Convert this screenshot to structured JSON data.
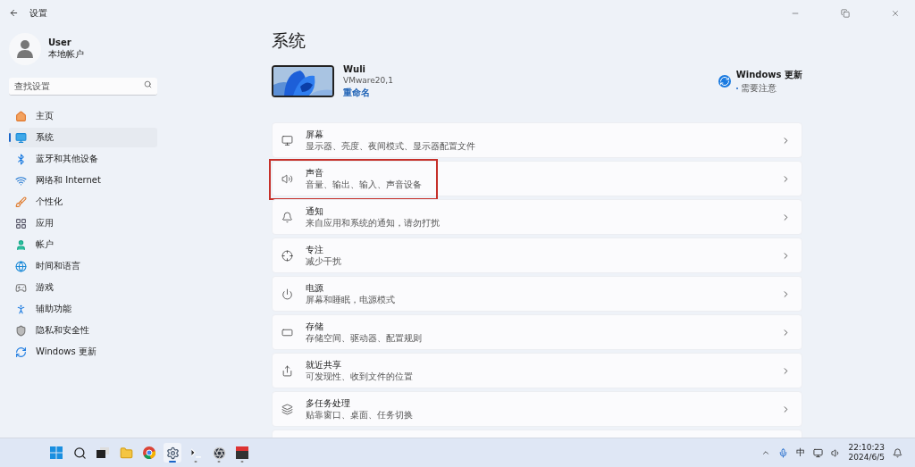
{
  "window": {
    "title": "设置"
  },
  "account": {
    "name": "User",
    "type": "本地帐户"
  },
  "search": {
    "placeholder": "查找设置"
  },
  "nav": [
    {
      "label": "主页",
      "selected": false
    },
    {
      "label": "系统",
      "selected": true
    },
    {
      "label": "蓝牙和其他设备",
      "selected": false
    },
    {
      "label": "网络和 Internet",
      "selected": false
    },
    {
      "label": "个性化",
      "selected": false
    },
    {
      "label": "应用",
      "selected": false
    },
    {
      "label": "帐户",
      "selected": false
    },
    {
      "label": "时间和语言",
      "selected": false
    },
    {
      "label": "游戏",
      "selected": false
    },
    {
      "label": "辅助功能",
      "selected": false
    },
    {
      "label": "隐私和安全性",
      "selected": false
    },
    {
      "label": "Windows 更新",
      "selected": false
    }
  ],
  "page_title": "系统",
  "device": {
    "name": "Wuli",
    "model": "VMware20,1",
    "rename": "重命名"
  },
  "update": {
    "title": "Windows 更新",
    "status": "需要注意"
  },
  "settings": [
    {
      "title": "屏幕",
      "subtitle": "显示器、亮度、夜间模式、显示器配置文件",
      "highlighted": false
    },
    {
      "title": "声音",
      "subtitle": "音量、输出、输入、声音设备",
      "highlighted": true
    },
    {
      "title": "通知",
      "subtitle": "来自应用和系统的通知，请勿打扰",
      "highlighted": false
    },
    {
      "title": "专注",
      "subtitle": "减少干扰",
      "highlighted": false
    },
    {
      "title": "电源",
      "subtitle": "屏幕和睡眠，电源模式",
      "highlighted": false
    },
    {
      "title": "存储",
      "subtitle": "存储空间、驱动器、配置规则",
      "highlighted": false
    },
    {
      "title": "就近共享",
      "subtitle": "可发现性、收到文件的位置",
      "highlighted": false
    },
    {
      "title": "多任务处理",
      "subtitle": "贴靠窗口、桌面、任务切换",
      "highlighted": false
    }
  ],
  "taskbar": {
    "apps": [
      {
        "selected": false
      },
      {
        "selected": false
      },
      {
        "selected": false
      },
      {
        "selected": false
      },
      {
        "selected": false
      },
      {
        "selected": true
      },
      {
        "selected": false
      },
      {
        "selected": false
      },
      {
        "selected": false
      }
    ],
    "ime": "中",
    "time": "22:10:23",
    "date": "2024/6/5"
  }
}
